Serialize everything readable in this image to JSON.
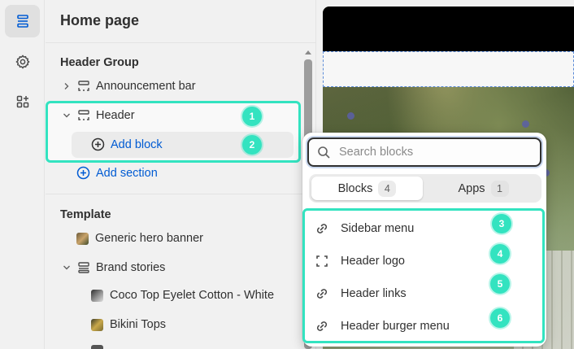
{
  "rail": {
    "items": [
      {
        "name": "sections-icon",
        "active": true
      },
      {
        "name": "settings-icon",
        "active": false
      },
      {
        "name": "apps-icon",
        "active": false
      }
    ]
  },
  "sidebar": {
    "title": "Home page",
    "header_group": {
      "title": "Header Group",
      "items": [
        "Announcement bar",
        "Header"
      ],
      "add_block": "Add block",
      "add_section": "Add section"
    },
    "template": {
      "title": "Template",
      "items": [
        "Generic hero banner",
        "Brand stories",
        "Coco Top Eyelet Cotton - White",
        "Bikini Tops"
      ]
    }
  },
  "badges": [
    "1",
    "2",
    "3",
    "4",
    "5",
    "6"
  ],
  "popup": {
    "search_placeholder": "Search blocks",
    "tabs": [
      {
        "label": "Blocks",
        "count": "4",
        "active": true
      },
      {
        "label": "Apps",
        "count": "1",
        "active": false
      }
    ],
    "blocks": [
      {
        "label": "Sidebar menu",
        "icon": "link-icon"
      },
      {
        "label": "Header logo",
        "icon": "image-frame-icon"
      },
      {
        "label": "Header links",
        "icon": "link-icon"
      },
      {
        "label": "Header burger menu",
        "icon": "link-icon"
      }
    ]
  },
  "colors": {
    "highlight": "#33e3c0",
    "link": "#005bd3",
    "text": "#303030"
  }
}
